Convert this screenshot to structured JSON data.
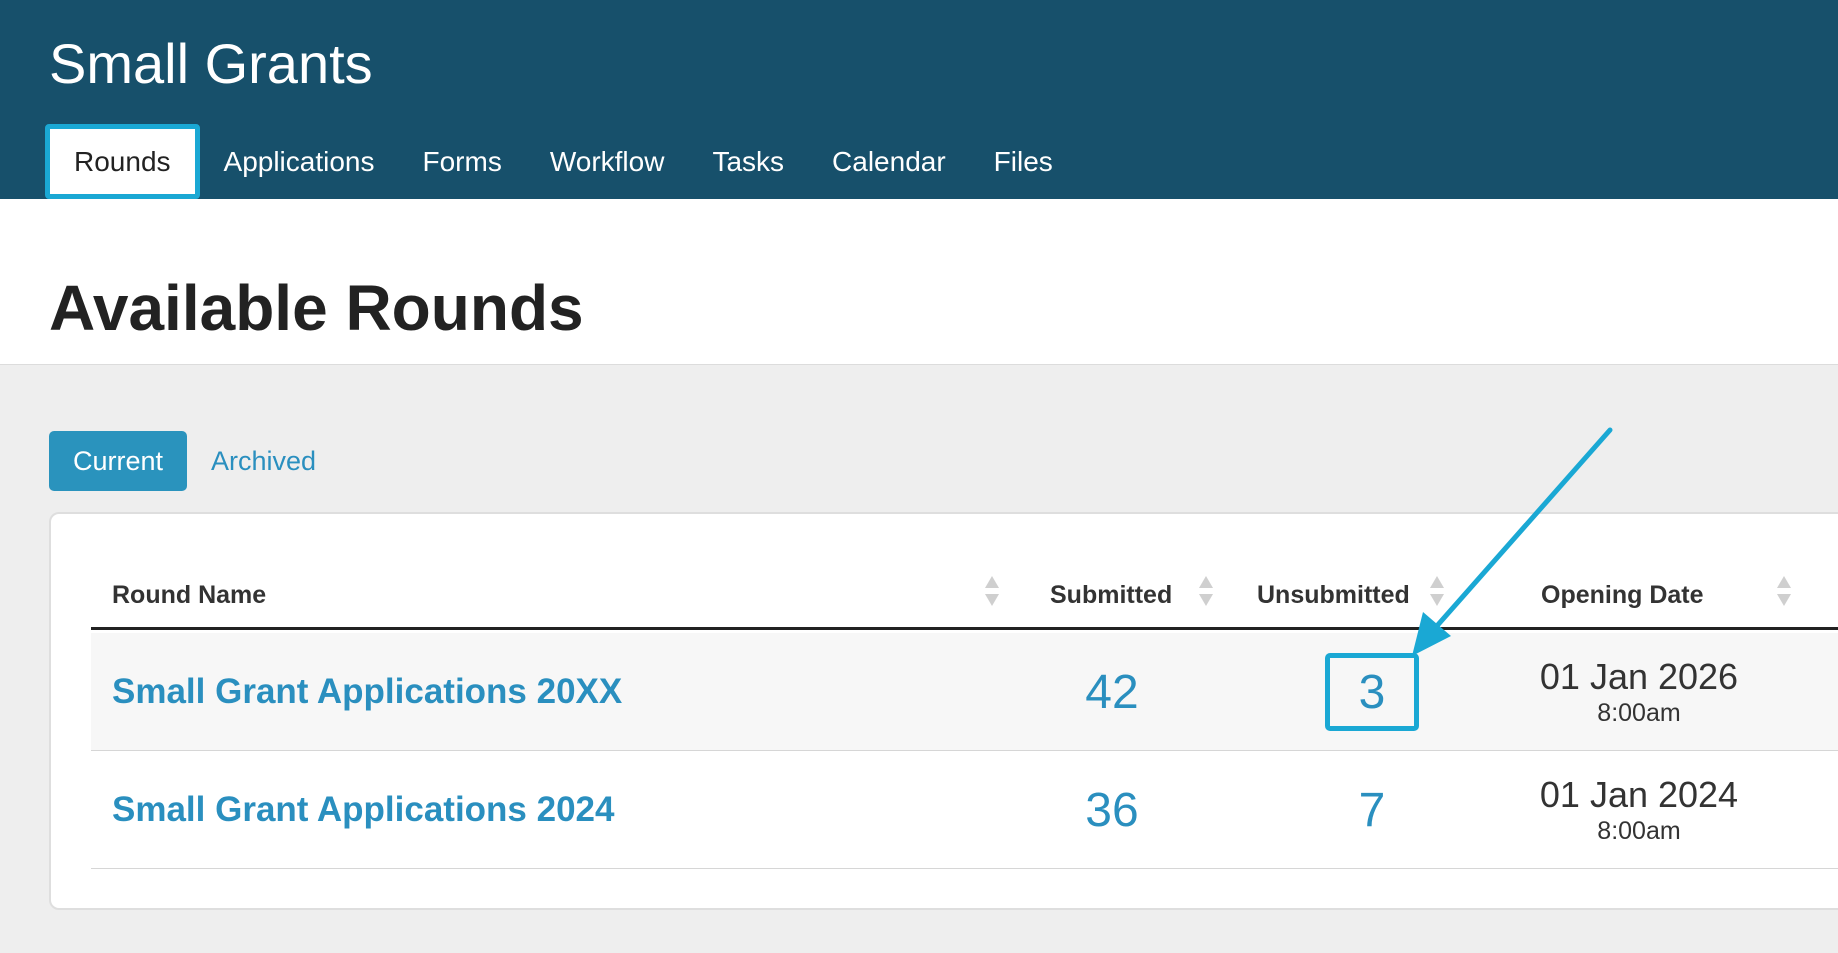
{
  "app": {
    "title": "Small Grants"
  },
  "nav": {
    "items": [
      {
        "label": "Rounds",
        "active": true
      },
      {
        "label": "Applications"
      },
      {
        "label": "Forms"
      },
      {
        "label": "Workflow"
      },
      {
        "label": "Tasks"
      },
      {
        "label": "Calendar"
      },
      {
        "label": "Files"
      }
    ]
  },
  "page": {
    "title": "Available Rounds"
  },
  "tabs": {
    "current": "Current",
    "archived": "Archived"
  },
  "table": {
    "columns": {
      "round_name": "Round Name",
      "submitted": "Submitted",
      "unsubmitted": "Unsubmitted",
      "opening_date": "Opening Date"
    },
    "rows": [
      {
        "name": "Small Grant Applications 20XX",
        "submitted": "42",
        "unsubmitted": "3",
        "opening_date": "01 Jan 2026",
        "opening_time": "8:00am"
      },
      {
        "name": "Small Grant Applications 2024",
        "submitted": "36",
        "unsubmitted": "7",
        "opening_date": "01 Jan 2024",
        "opening_time": "8:00am"
      }
    ]
  },
  "colors": {
    "header_bg": "#17506b",
    "accent": "#2a8fbf",
    "highlight": "#1aa8d4"
  }
}
